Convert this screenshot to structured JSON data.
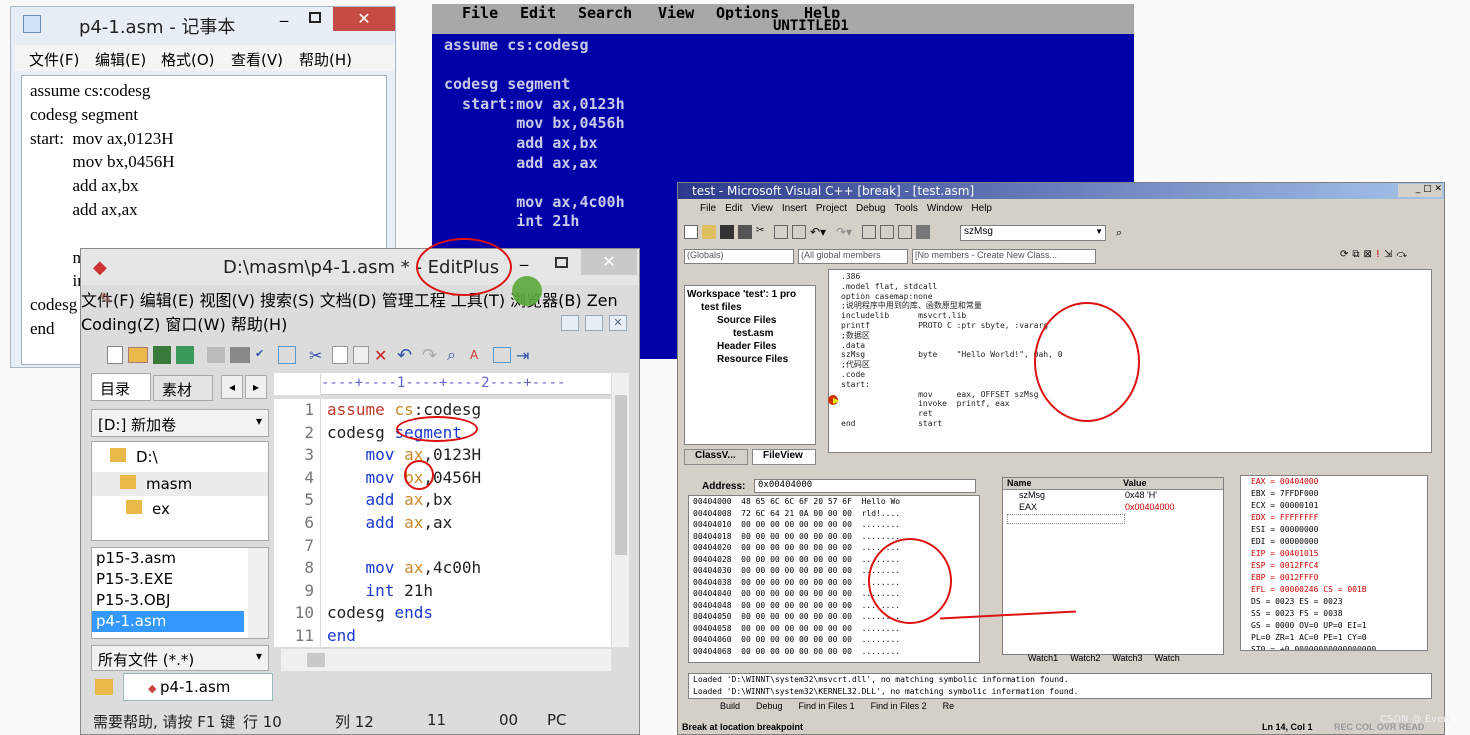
{
  "notepad": {
    "title": "p4-1.asm - 记事本",
    "menu": [
      "文件(F)",
      "编辑(E)",
      "格式(O)",
      "查看(V)",
      "帮助(H)"
    ],
    "lines": [
      "assume cs:codesg",
      "codesg segment",
      "start:  mov ax,0123H",
      "          mov bx,0456H",
      "          add ax,bx",
      "          add ax,ax",
      "",
      "          mov ax,4c00h",
      "          int 21h",
      "codesg ends",
      "end"
    ]
  },
  "dos": {
    "menu": [
      "File",
      "Edit",
      "Search",
      "View",
      "Options",
      "Help"
    ],
    "title": "UNTITLED1",
    "lines": [
      "assume cs:codesg",
      "",
      "codesg segment",
      "  start:mov ax,0123h",
      "        mov bx,0456h",
      "        add ax,bx",
      "        add ax,ax",
      "",
      "        mov ax,4c00h",
      "        int 21h"
    ]
  },
  "editplus": {
    "title": "D:\\masm\\p4-1.asm * - EditPlus",
    "menu1": [
      "文件(F)",
      "编辑(E)",
      "视图(V)",
      "搜索(S)",
      "文档(D)",
      "管理工程",
      "工具(T)"
    ],
    "menu2": [
      "浏览器(B)",
      "Zen Coding(Z)",
      "窗口(W)",
      "帮助(H)"
    ],
    "tabs": [
      "目录",
      "素材"
    ],
    "drive": "[D:] 新加卷",
    "folders": [
      "D:\\",
      "masm",
      "ex"
    ],
    "files": [
      "p15-3.asm",
      "P15-3.EXE",
      "P15-3.OBJ",
      "p4-1.asm"
    ],
    "filter": "所有文件 (*.*)",
    "ruler": "----+----1----+----2----+----",
    "line_numbers": [
      "1",
      "2",
      "3",
      "4",
      "5",
      "6",
      "7",
      "8",
      "9",
      "10",
      "11"
    ],
    "code": [
      [
        [
          "kw",
          "assume "
        ],
        [
          "op",
          "cs"
        ],
        [
          "t",
          ":codesg"
        ]
      ],
      [
        [
          "t",
          "codesg "
        ],
        [
          "kw2",
          "segment"
        ]
      ],
      [
        [
          "t",
          "    "
        ],
        [
          "kw2",
          "mov "
        ],
        [
          "op",
          "ax"
        ],
        [
          "t",
          ",0123H"
        ]
      ],
      [
        [
          "t",
          "    "
        ],
        [
          "kw2",
          "mov "
        ],
        [
          "op",
          "bx"
        ],
        [
          "t",
          ",0456H"
        ]
      ],
      [
        [
          "t",
          "    "
        ],
        [
          "kw2",
          "add "
        ],
        [
          "op",
          "ax"
        ],
        [
          "t",
          ",bx"
        ]
      ],
      [
        [
          "t",
          "    "
        ],
        [
          "kw2",
          "add "
        ],
        [
          "op",
          "ax"
        ],
        [
          "t",
          ",ax"
        ]
      ],
      [
        [
          "t",
          ""
        ]
      ],
      [
        [
          "t",
          "    "
        ],
        [
          "kw2",
          "mov "
        ],
        [
          "op",
          "ax"
        ],
        [
          "t",
          ",4c00h"
        ]
      ],
      [
        [
          "t",
          "    "
        ],
        [
          "kw2",
          "int "
        ],
        [
          "t",
          "21h"
        ]
      ],
      [
        [
          "t",
          "codesg "
        ],
        [
          "kw2",
          "ends"
        ]
      ],
      [
        [
          "kw2",
          "end"
        ]
      ]
    ],
    "doc_tab": "p4-1.asm",
    "status": {
      "help": "需要帮助, 请按 F1 键",
      "row": "行 10",
      "col": "列 12",
      "n1": "11",
      "n2": "00",
      "mode": "PC"
    }
  },
  "vc": {
    "title": "test - Microsoft Visual C++ [break] - [test.asm]",
    "menu": [
      "File",
      "Edit",
      "View",
      "Insert",
      "Project",
      "Debug",
      "Tools",
      "Window",
      "Help"
    ],
    "find": "szMsg",
    "globals": "(Globals)",
    "members": "(All global members",
    "nomembers": "[No members - Create New Class...",
    "workspace": [
      "Workspace 'test': 1 pro",
      "test files",
      "Source Files",
      "test.asm",
      "Header Files",
      "Resource Files"
    ],
    "ws_tabs": [
      "ClassV...",
      "FileView"
    ],
    "source": [
      ".386",
      ".model flat, stdcall",
      "option casemap:none",
      ";说明程序中用到的库、函数原型和常量",
      "includelib      msvcrt.lib",
      "printf          PROTO C :ptr sbyte, :vararg",
      ";数据区",
      ".data",
      "szMsg           byte    \"Hello World!\", 0ah, 0",
      ";代码区",
      ".code",
      "start:",
      "                mov     eax, OFFSET szMsg",
      "                invoke  printf, eax",
      "                ret",
      "end             start"
    ],
    "address_label": "Address:",
    "address": "0x00404000",
    "memory": [
      "00404000  48 65 6C 6C 6F 20 57 6F  Hello Wo",
      "00404008  72 6C 64 21 0A 00 00 00  rld!....",
      "00404010  00 00 00 00 00 00 00 00  ........",
      "00404018  00 00 00 00 00 00 00 00  ........",
      "00404020  00 00 00 00 00 00 00 00  ........",
      "00404028  00 00 00 00 00 00 00 00  ........",
      "00404030  00 00 00 00 00 00 00 00  ........",
      "00404038  00 00 00 00 00 00 00 00  ........",
      "00404040  00 00 00 00 00 00 00 00  ........",
      "00404048  00 00 00 00 00 00 00 00  ........",
      "00404050  00 00 00 00 00 00 00 00  ........",
      "00404058  00 00 00 00 00 00 00 00  ........",
      "00404060  00 00 00 00 00 00 00 00  ........",
      "00404068  00 00 00 00 00 00 00 00  ........"
    ],
    "watch_head": [
      "Name",
      "Value"
    ],
    "watch": [
      [
        "szMsg",
        "0x48 'H'"
      ],
      [
        "EAX",
        "0x00404000"
      ]
    ],
    "watch_tabs": [
      "Watch1",
      "Watch2",
      "Watch3",
      "Watch"
    ],
    "registers": [
      "EAX = 00404000",
      "EBX = 7FFDF000",
      "ECX = 00000101",
      "EDX = FFFFFFFF",
      "ESI = 00000000",
      "EDI = 00000000",
      "EIP = 00401015",
      "ESP = 0012FFC4",
      "EBP = 0012FFF0",
      "EFL = 00000246 CS = 001B",
      "DS = 0023 ES = 0023",
      "SS = 0023 FS = 0038",
      "GS = 0000 OV=0 UP=0 EI=1",
      "PL=0 ZR=1 AC=0 PE=1 CY=0",
      "ST0 = +0.00000000000000000"
    ],
    "output": [
      "Loaded 'D:\\WINNT\\system32\\msvcrt.dll', no matching symbolic information found.",
      "Loaded 'D:\\WINNT\\system32\\KERNEL32.DLL', no matching symbolic information found."
    ],
    "out_tabs": [
      "Build",
      "Debug",
      "Find in Files 1",
      "Find in Files 2",
      "Re"
    ],
    "status": "Break at location breakpoint",
    "pos": "Ln 14, Col 1",
    "flags": "REC COL OVR READ"
  },
  "watermark": "CSDN @ Even"
}
